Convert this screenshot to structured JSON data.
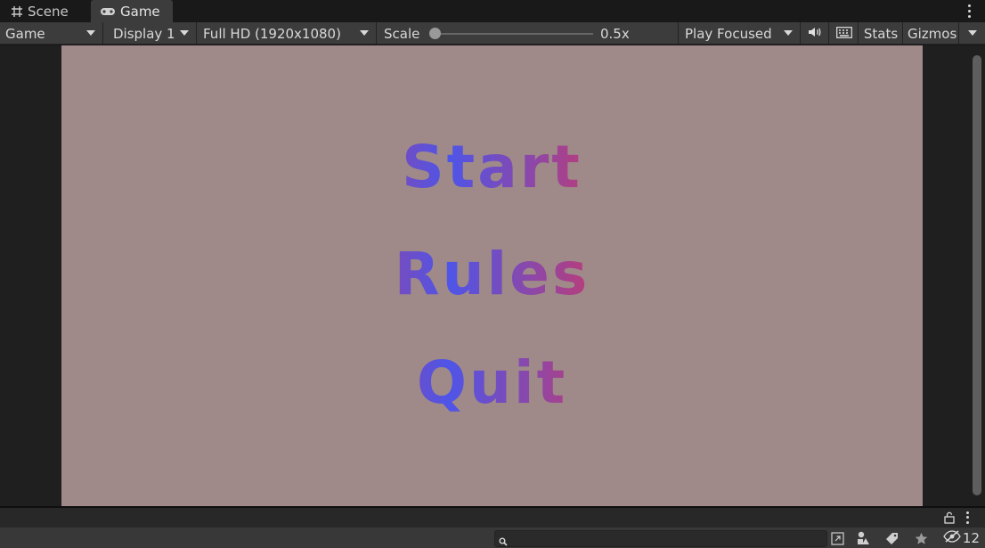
{
  "tabs": [
    {
      "label": "Scene",
      "icon": "grid-icon"
    },
    {
      "label": "Game",
      "icon": "gamepad-icon",
      "active": true
    }
  ],
  "toolbar": {
    "view_mode": "Game",
    "display": "Display 1",
    "resolution": "Full HD (1920x1080)",
    "scale_label": "Scale",
    "scale_value": "0.5x",
    "play_mode": "Play Focused",
    "stats_label": "Stats",
    "gizmos_label": "Gizmos"
  },
  "game": {
    "background": "#9f8a89",
    "buttons": [
      "Start",
      "Rules",
      "Quit"
    ],
    "gradient_colors": [
      "#4e55e8",
      "#e3344f"
    ]
  },
  "statusbar": {
    "search_placeholder": "",
    "hidden_count": "12"
  }
}
